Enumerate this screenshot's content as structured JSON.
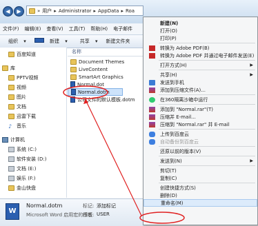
{
  "address": {
    "crumbs": [
      "用户",
      "Administrator",
      "AppData",
      "Roa"
    ]
  },
  "menubar": [
    "文件(F)",
    "编辑(E)",
    "查看(V)",
    "工具(T)",
    "帮助(H)",
    "电子邮件"
  ],
  "toolbar": {
    "organize": "组织",
    "new": "新建",
    "share": "共享",
    "new_folder": "新建文件夹"
  },
  "nav": [
    {
      "label": "百度知道",
      "icon": "folder-icon",
      "group": false
    },
    {
      "label": "库",
      "icon": "library-icon",
      "group": true
    },
    {
      "label": "PPTV视频",
      "icon": "video-icon",
      "group": false
    },
    {
      "label": "视频",
      "icon": "video-icon",
      "group": false
    },
    {
      "label": "图片",
      "icon": "image-icon",
      "group": false
    },
    {
      "label": "文档",
      "icon": "document-icon",
      "group": false
    },
    {
      "label": "迅雷下载",
      "icon": "download-icon",
      "group": false
    },
    {
      "label": "音乐",
      "icon": "music-icon",
      "group": false
    },
    {
      "label": "计算机",
      "icon": "computer-icon",
      "group": true
    },
    {
      "label": "系统 (C:)",
      "icon": "drive-icon",
      "group": false
    },
    {
      "label": "软件安装 (D:)",
      "icon": "drive-icon",
      "group": false
    },
    {
      "label": "文档 (E:)",
      "icon": "drive-icon",
      "group": false
    },
    {
      "label": "娱乐 (F:)",
      "icon": "drive-icon",
      "group": false
    },
    {
      "label": "金山快盘",
      "icon": "cloud-drive-icon",
      "group": false
    }
  ],
  "filelist": {
    "column_name": "名称",
    "files": [
      {
        "name": "Document Themes",
        "type": "folder"
      },
      {
        "name": "LiveContent",
        "type": "folder"
      },
      {
        "name": "SmartArt Graphics",
        "type": "folder"
      },
      {
        "name": "Normal.dot",
        "type": "doc"
      },
      {
        "name": "Normal.dotm",
        "type": "doc",
        "selected": true
      },
      {
        "name": "公司文件的默认模板.dotm",
        "type": "doc"
      }
    ]
  },
  "details": {
    "filename": "Normal.dotm",
    "type": "Microsoft Word 启用宏的模板",
    "tags_label": "标记:",
    "tags_value": "添加标记",
    "author_label": "作者:",
    "author_value": "USER"
  },
  "context_menu": [
    {
      "label": "新建(N)",
      "bold": true
    },
    {
      "label": "打开(O)"
    },
    {
      "label": "打印(P)"
    },
    {
      "sep": true
    },
    {
      "label": "转换为 Adobe PDF(B)",
      "icon": "pdf-icon"
    },
    {
      "label": "转换为 Adobe PDF 并通过电子邮件发送(E)",
      "icon": "pdf-icon"
    },
    {
      "sep": true
    },
    {
      "label": "打开方式(H)",
      "submenu": true
    },
    {
      "sep": true
    },
    {
      "label": "共享(H)",
      "submenu": true
    },
    {
      "label": "发送到手机",
      "icon": "phone-icon"
    },
    {
      "label": "添加到压缩文件(A)...",
      "icon": "rar-icon"
    },
    {
      "sep": true
    },
    {
      "label": "在360隔离沙箱中运行",
      "icon": "360-icon"
    },
    {
      "sep": true
    },
    {
      "label": "添加到 \"Normal.rar\"(T)",
      "icon": "rar-icon"
    },
    {
      "label": "压缩并 E-mail...",
      "icon": "rar-icon"
    },
    {
      "label": "压缩到 \"Normal.rar\" 并 E-mail",
      "icon": "rar-icon"
    },
    {
      "sep": true
    },
    {
      "label": "上传到百度云",
      "icon": "baidu-cloud-icon"
    },
    {
      "label": "自动备份到百度云",
      "icon": "baidu-cloud-icon",
      "disabled": true
    },
    {
      "sep": true
    },
    {
      "label": "还原以前的版本(V)"
    },
    {
      "sep": true
    },
    {
      "label": "发送到(N)",
      "submenu": true
    },
    {
      "sep": true
    },
    {
      "label": "剪切(T)"
    },
    {
      "label": "复制(C)"
    },
    {
      "sep": true
    },
    {
      "label": "创建快捷方式(S)"
    },
    {
      "label": "删除(D)"
    },
    {
      "label": "重命名(M)",
      "highlighted": true
    }
  ],
  "colors": {
    "annotation": "#e02020",
    "menu_highlight": "#dcebfb",
    "selection": "#cde3fb"
  }
}
